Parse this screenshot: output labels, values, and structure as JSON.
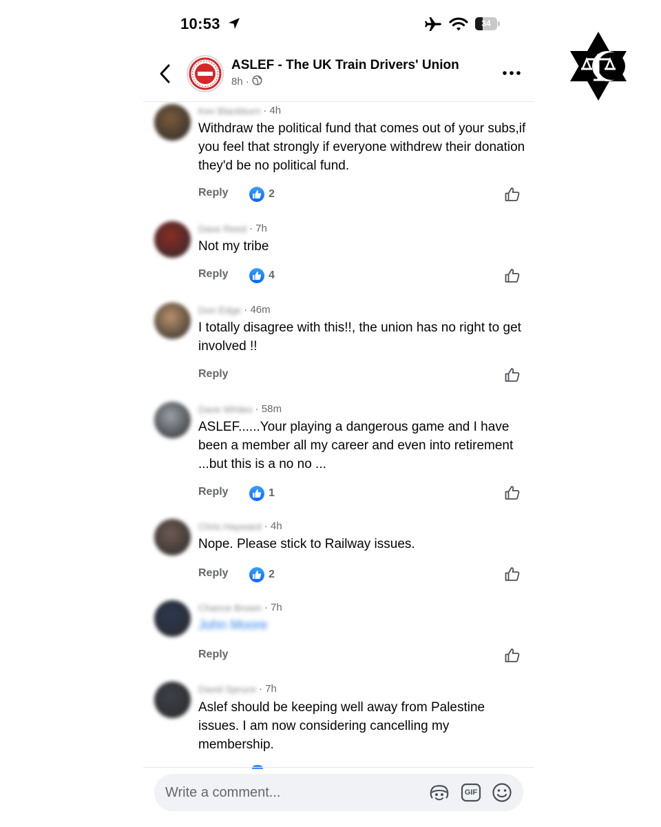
{
  "status_bar": {
    "time": "10:53",
    "battery": "34",
    "battery_level": 0.34
  },
  "post": {
    "page_name": "ASLEF - The UK Train Drivers' Union",
    "age": "8h",
    "separator": "·",
    "audience_icon": "globe-icon"
  },
  "labels": {
    "reply": "Reply"
  },
  "comments": [
    {
      "author": "Kev Blackburn",
      "time": "4h",
      "text": "Withdraw the political fund that comes out of your subs,if you feel that strongly if everyone withdrew their donation they'd be no political fund.",
      "likes": "2",
      "avatar_color": "#7a5a3a"
    },
    {
      "author": "Dave Reed",
      "time": "7h",
      "text": "Not my tribe",
      "likes": "4",
      "avatar_color": "#8c2b25"
    },
    {
      "author": "Don Edge",
      "time": "46m",
      "text": "I totally disagree with this!!, the union has no right to get involved !!",
      "likes": "",
      "avatar_color": "#b8906a"
    },
    {
      "author": "Dave Whiles",
      "time": "58m",
      "text": "ASLEF......Your playing a dangerous game and I have been a member all my career and even into retirement ...but this is a no no ...",
      "likes": "1",
      "avatar_color": "#9aa1a8"
    },
    {
      "author": "Chris Hayward",
      "time": "4h",
      "text": "Nope. Please stick to Railway issues.",
      "likes": "2",
      "avatar_color": "#6e5a52"
    },
    {
      "author": "Chance Brown",
      "time": "7h",
      "text": "John Moore",
      "likes": "",
      "avatar_color": "#2c3850",
      "text_is_tag": true
    },
    {
      "author": "David Spruce",
      "time": "7h",
      "text": "Aslef should be keeping well away from Palestine issues. I am now considering cancelling my membership.",
      "likes": "",
      "avatar_color": "#3c4048"
    }
  ],
  "composer": {
    "placeholder": "Write a comment...",
    "gif_label": "GIF"
  },
  "colors": {
    "accent": "#0866ff",
    "secondary_text": "#65676b",
    "composer_bg": "#f0f2f5"
  }
}
